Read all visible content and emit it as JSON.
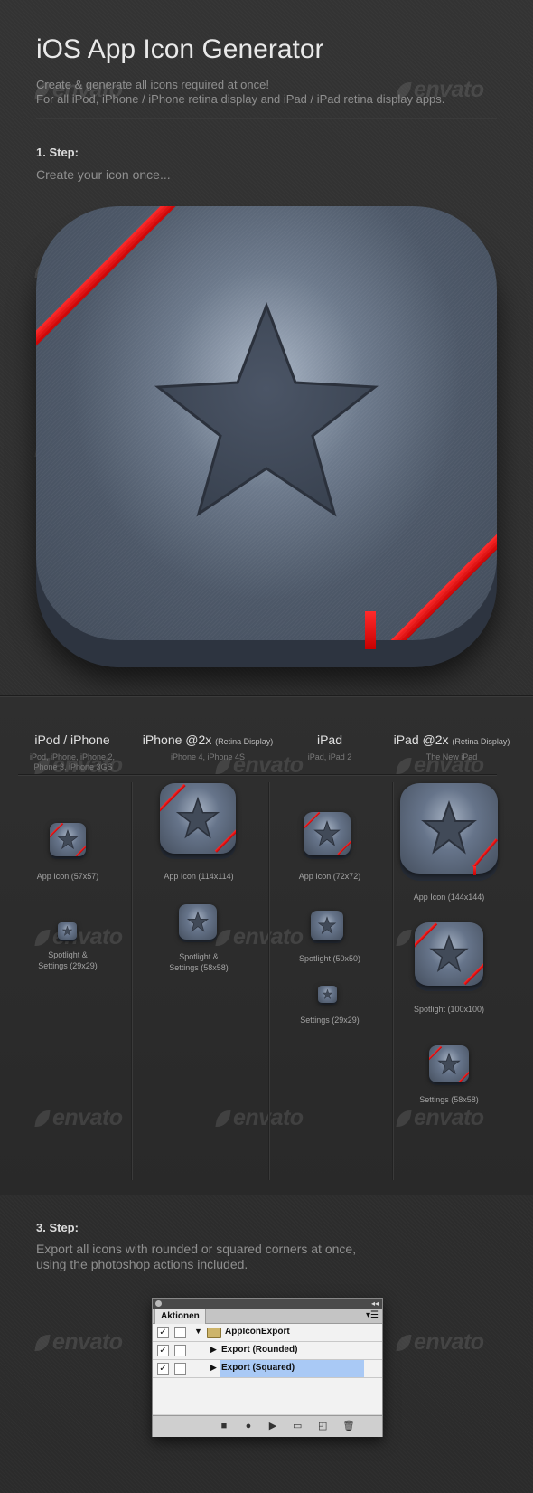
{
  "header": {
    "title": "iOS App Icon Generator",
    "subtitle_line1": "Create & generate all icons required at once!",
    "subtitle_line2": "For all iPod, iPhone / iPhone retina display and iPad / iPad retina display apps."
  },
  "step1": {
    "title": "1. Step:",
    "description": "Create your icon once..."
  },
  "watermark": "envato",
  "columns": [
    {
      "title": "iPod / iPhone",
      "note": "",
      "devices_line1": "iPod, iPhone, iPhone 2,",
      "devices_line2": "iPhone 3, iPhone 3GS"
    },
    {
      "title": "iPhone @2x",
      "note": "(Retina Display)",
      "devices_line1": "iPhone 4, iPhone 4S",
      "devices_line2": ""
    },
    {
      "title": "iPad",
      "note": "",
      "devices_line1": "iPad, iPad 2",
      "devices_line2": ""
    },
    {
      "title": "iPad @2x",
      "note": "(Retina Display)",
      "devices_line1": "The New iPad",
      "devices_line2": ""
    }
  ],
  "icon_labels": {
    "c1_app": "App Icon (57x57)",
    "c1_spot_1": "Spotlight &",
    "c1_spot_2": "Settings (29x29)",
    "c2_app": "App Icon (114x114)",
    "c2_spot_1": "Spotlight &",
    "c2_spot_2": "Settings (58x58)",
    "c3_app": "App Icon (72x72)",
    "c3_spot": "Spotlight (50x50)",
    "c3_set": "Settings (29x29)",
    "c4_app": "App Icon (144x144)",
    "c4_spot": "Spotlight (100x100)",
    "c4_set": "Settings (58x58)"
  },
  "step3": {
    "title": "3. Step:",
    "description_line1": "Export all icons with rounded or squared corners at once,",
    "description_line2": "using the photoshop actions included."
  },
  "actions_panel": {
    "tab": "Aktionen",
    "items": [
      {
        "label": "AppIconExport",
        "checked": true,
        "selected": false
      },
      {
        "label": "Export (Rounded)",
        "checked": true,
        "selected": false
      },
      {
        "label": "Export (Squared)",
        "checked": true,
        "selected": true
      }
    ],
    "colors": {
      "selected": "#a9c9f5"
    }
  }
}
